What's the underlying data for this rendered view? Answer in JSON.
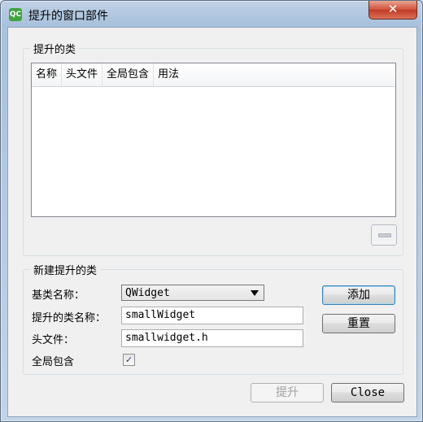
{
  "window": {
    "title": "提升的窗口部件",
    "app_icon_text": "QC",
    "close_glyph": "✕"
  },
  "promoted_group": {
    "title": "提升的类",
    "columns": [
      "名称",
      "头文件",
      "全局包含",
      "用法"
    ]
  },
  "new_group": {
    "title": "新建提升的类",
    "base_class_label": "基类名称：",
    "base_class_value": "QWidget",
    "class_name_label": "提升的类名称：",
    "class_name_value": "smallWidget",
    "header_label": "头文件：",
    "header_value": "smallwidget.h",
    "global_include_label": "全局包含",
    "global_include_checked": true,
    "add_label": "添加",
    "reset_label": "重置"
  },
  "footer": {
    "promote_label": "提升",
    "close_label": "Close"
  }
}
